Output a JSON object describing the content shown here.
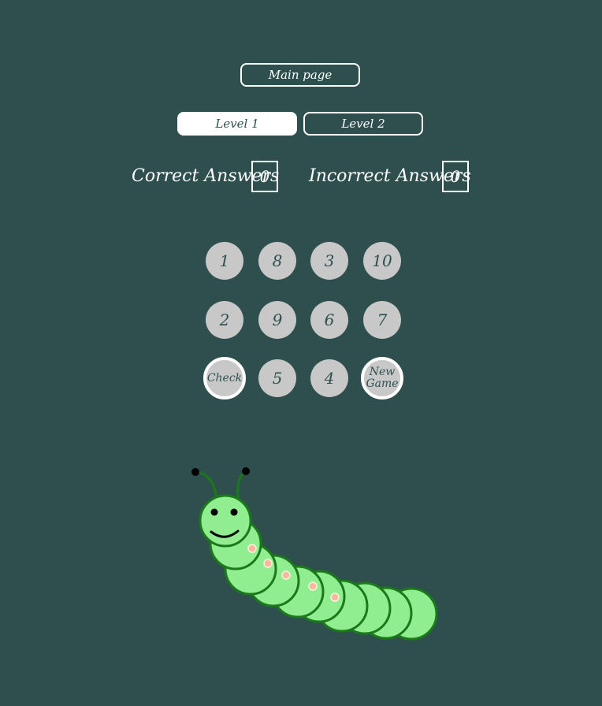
{
  "nav": {
    "main_page_label": "Main page"
  },
  "levels": {
    "level1_label": "Level 1",
    "level2_label": "Level 2",
    "active": "Level 1"
  },
  "score": {
    "correct_label": "Correct Answers",
    "correct_value": "0",
    "incorrect_label": "Incorrect Answers",
    "incorrect_value": "0"
  },
  "grid": {
    "row1": [
      "1",
      "8",
      "3",
      "10"
    ],
    "row2": [
      "2",
      "9",
      "6",
      "7"
    ],
    "row3_numbers": [
      "5",
      "4"
    ],
    "check_label": "Check",
    "new_game_label": "New Game"
  },
  "colors": {
    "background": "#2f4f4f",
    "button_fill": "#c8c8c8",
    "caterpillar_body": "#90ee90",
    "caterpillar_outline": "#1a7a1a"
  }
}
